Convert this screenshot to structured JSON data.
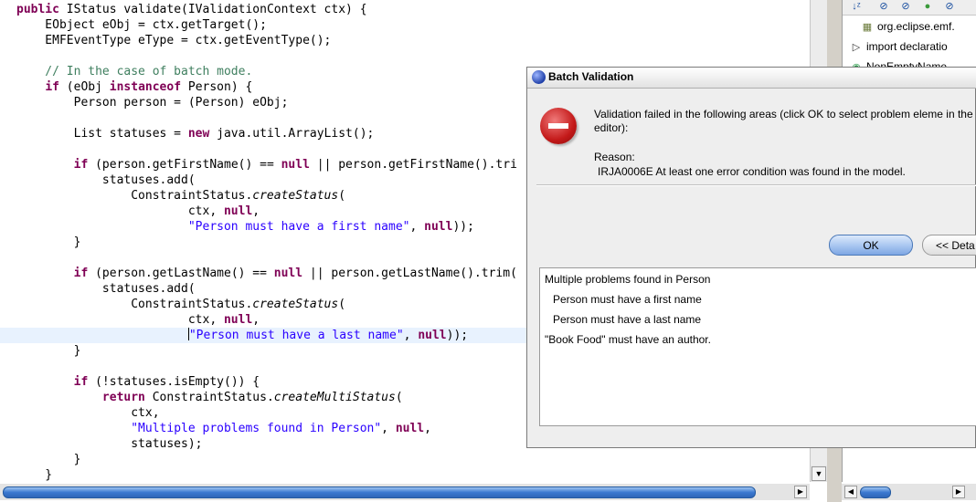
{
  "editor": {
    "lines": [
      {
        "segments": [
          {
            "t": "public",
            "c": "kw"
          },
          {
            "t": " IStatus validate(IValidationContext ctx) {"
          }
        ]
      },
      {
        "segments": [
          {
            "t": "    EObject eObj = ctx.getTarget();"
          }
        ]
      },
      {
        "segments": [
          {
            "t": "    EMFEventType eType = ctx.getEventType();"
          }
        ]
      },
      {
        "segments": []
      },
      {
        "segments": [
          {
            "t": "    // In the case of batch mode.",
            "c": "cm"
          }
        ]
      },
      {
        "segments": [
          {
            "t": "    "
          },
          {
            "t": "if",
            "c": "kw"
          },
          {
            "t": " (eObj "
          },
          {
            "t": "instanceof",
            "c": "kw"
          },
          {
            "t": " Person) {"
          }
        ]
      },
      {
        "segments": [
          {
            "t": "        Person person = (Person) eObj;"
          }
        ]
      },
      {
        "segments": []
      },
      {
        "segments": [
          {
            "t": "        List statuses = "
          },
          {
            "t": "new",
            "c": "kw"
          },
          {
            "t": " java.util.ArrayList();"
          }
        ]
      },
      {
        "segments": []
      },
      {
        "segments": [
          {
            "t": "        "
          },
          {
            "t": "if",
            "c": "kw"
          },
          {
            "t": " (person.getFirstName() == "
          },
          {
            "t": "null",
            "c": "kw"
          },
          {
            "t": " || person.getFirstName().tri"
          }
        ]
      },
      {
        "segments": [
          {
            "t": "            statuses.add("
          }
        ]
      },
      {
        "segments": [
          {
            "t": "                ConstraintStatus."
          },
          {
            "t": "createStatus",
            "c": "it"
          },
          {
            "t": "("
          }
        ]
      },
      {
        "segments": [
          {
            "t": "                        ctx, "
          },
          {
            "t": "null",
            "c": "kw"
          },
          {
            "t": ","
          }
        ]
      },
      {
        "segments": [
          {
            "t": "                        "
          },
          {
            "t": "\"Person must have a first name\"",
            "c": "st"
          },
          {
            "t": ", "
          },
          {
            "t": "null",
            "c": "kw"
          },
          {
            "t": "));"
          }
        ]
      },
      {
        "segments": [
          {
            "t": "        }"
          }
        ]
      },
      {
        "segments": []
      },
      {
        "segments": [
          {
            "t": "        "
          },
          {
            "t": "if",
            "c": "kw"
          },
          {
            "t": " (person.getLastName() == "
          },
          {
            "t": "null",
            "c": "kw"
          },
          {
            "t": " || person.getLastName().trim("
          }
        ]
      },
      {
        "segments": [
          {
            "t": "            statuses.add("
          }
        ]
      },
      {
        "segments": [
          {
            "t": "                ConstraintStatus."
          },
          {
            "t": "createStatus",
            "c": "it"
          },
          {
            "t": "("
          }
        ]
      },
      {
        "segments": [
          {
            "t": "                        ctx, "
          },
          {
            "t": "null",
            "c": "kw"
          },
          {
            "t": ","
          }
        ]
      },
      {
        "segments": [
          {
            "t": "                        "
          },
          {
            "t": "|",
            "c": "caret"
          },
          {
            "t": "\"Person must have a last name\"",
            "c": "st"
          },
          {
            "t": ", "
          },
          {
            "t": "null",
            "c": "kw"
          },
          {
            "t": "));"
          }
        ],
        "current": true
      },
      {
        "segments": [
          {
            "t": "        }"
          }
        ]
      },
      {
        "segments": []
      },
      {
        "segments": [
          {
            "t": "        "
          },
          {
            "t": "if",
            "c": "kw"
          },
          {
            "t": " (!statuses.isEmpty()) {"
          }
        ]
      },
      {
        "segments": [
          {
            "t": "            "
          },
          {
            "t": "return",
            "c": "kw"
          },
          {
            "t": " ConstraintStatus."
          },
          {
            "t": "createMultiStatus",
            "c": "it"
          },
          {
            "t": "("
          }
        ]
      },
      {
        "segments": [
          {
            "t": "                ctx,"
          }
        ]
      },
      {
        "segments": [
          {
            "t": "                "
          },
          {
            "t": "\"Multiple problems found in Person\"",
            "c": "st"
          },
          {
            "t": ", "
          },
          {
            "t": "null",
            "c": "kw"
          },
          {
            "t": ","
          }
        ]
      },
      {
        "segments": [
          {
            "t": "                statuses);"
          }
        ]
      },
      {
        "segments": [
          {
            "t": "        }"
          }
        ]
      },
      {
        "segments": [
          {
            "t": "    }"
          }
        ]
      }
    ]
  },
  "outline": {
    "items": [
      {
        "icon": "package-icon",
        "glyph": "▦",
        "label": "org.eclipse.emf."
      },
      {
        "icon": "expand-triangle-icon",
        "glyph": "▷",
        "label": "import declaratio"
      },
      {
        "icon": "class-icon",
        "glyph": "◉",
        "label": "NonEmptyName"
      }
    ]
  },
  "dialog": {
    "title": "Batch Validation",
    "message": "Validation failed in the following areas (click OK to select problem eleme in the editor):",
    "reason_label": "Reason:",
    "reason_text": "IRJA0006E At least one error condition was found in the model.",
    "ok_label": "OK",
    "details_label": "<< Deta",
    "details": [
      {
        "text": "Multiple problems found in Person",
        "indent": 0
      },
      {
        "text": "Person must have a first name",
        "indent": 1
      },
      {
        "text": "Person must have a last name",
        "indent": 1
      },
      {
        "text": "\"Book Food\" must have an author.",
        "indent": 0
      }
    ]
  }
}
